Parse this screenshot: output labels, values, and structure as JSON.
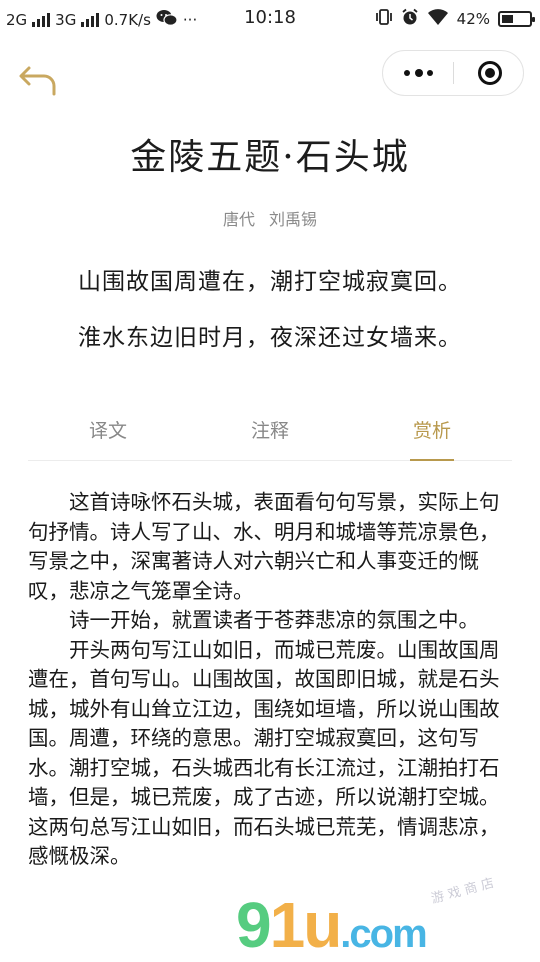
{
  "status_bar": {
    "sim1": "2G",
    "sim2": "3G",
    "speed": "0.7K/s",
    "wechat_icon": "wechat-icon",
    "more": "···",
    "time": "10:18",
    "battery": "42%",
    "battery_level": 0.42
  },
  "nav": {
    "back_icon": "back-arrow-icon",
    "more_icon": "more-dots-icon",
    "close_icon": "mini-program-close-icon"
  },
  "poem": {
    "title": "金陵五题·石头城",
    "dynasty": "唐代",
    "author": "刘禹锡",
    "lines": [
      "山围故国周遭在，潮打空城寂寞回。",
      "淮水东边旧时月，夜深还过女墙来。"
    ]
  },
  "tabs": [
    {
      "label": "译文",
      "active": false
    },
    {
      "label": "注释",
      "active": false
    },
    {
      "label": "赏析",
      "active": true
    }
  ],
  "accent_color": "#b8994d",
  "article": {
    "paragraphs": [
      "这首诗咏怀石头城，表面看句句写景，实际上句句抒情。诗人写了山、水、明月和城墙等荒凉景色，写景之中，深寓著诗人对六朝兴亡和人事变迁的慨叹，悲凉之气笼罩全诗。",
      "诗一开始，就置读者于苍莽悲凉的氛围之中。",
      "开头两句写江山如旧，而城已荒废。山围故国周遭在，首句写山。山围故国，故国即旧城，就是石头城，城外有山耸立江边，围绕如垣墙，所以说山围故国。周遭，环绕的意思。潮打空城寂寞回，这句写水。潮打空城，石头城西北有长江流过，江潮拍打石墙，但是，城已荒废，成了古迹，所以说潮打空城。这两句总写江山如旧，而石头城已荒芜，情调悲凉，感慨极深。"
    ]
  },
  "watermark": {
    "text_a": "9",
    "text_b": "1u",
    "text_c": ".com",
    "small": "游 戏 商 店"
  }
}
